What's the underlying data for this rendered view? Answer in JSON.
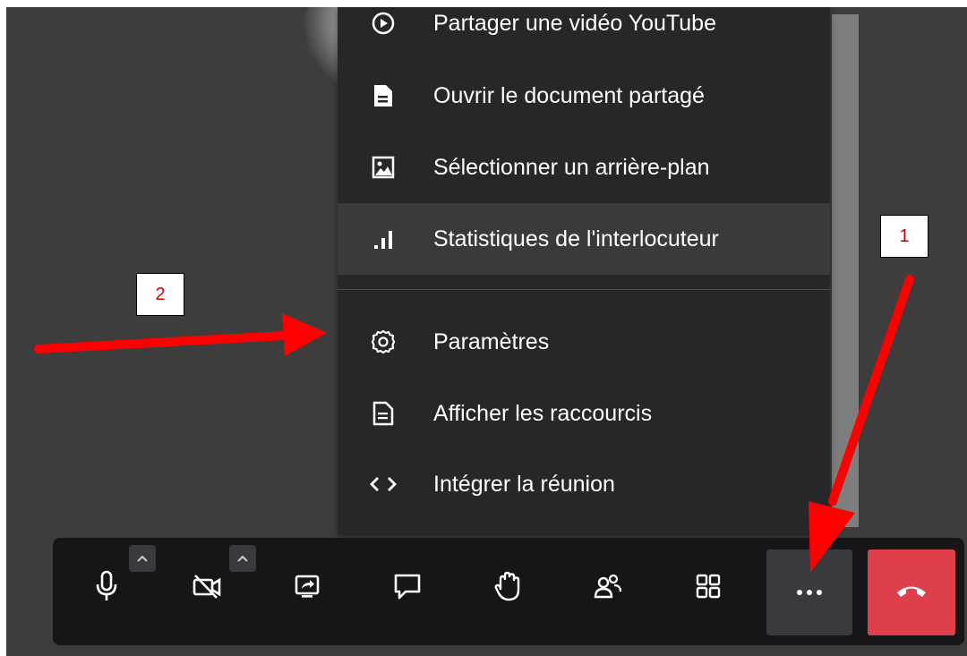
{
  "menu": {
    "items": [
      {
        "label": "Partager une vidéo YouTube",
        "icon": "play-circle-icon"
      },
      {
        "label": "Ouvrir le document partagé",
        "icon": "document-icon"
      },
      {
        "label": "Sélectionner un arrière-plan",
        "icon": "image-icon"
      },
      {
        "label": "Statistiques de l'interlocuteur",
        "icon": "signal-bars-icon"
      },
      {
        "label": "Paramètres",
        "icon": "gear-icon"
      },
      {
        "label": "Afficher les raccourcis",
        "icon": "shortcuts-document-icon"
      },
      {
        "label": "Intégrer la réunion",
        "icon": "code-embed-icon"
      }
    ]
  },
  "toolbar": {
    "buttons": [
      {
        "name": "microphone",
        "icon": "microphone-icon"
      },
      {
        "name": "camera",
        "icon": "camera-off-icon"
      },
      {
        "name": "share-screen",
        "icon": "screen-share-icon"
      },
      {
        "name": "chat",
        "icon": "chat-icon"
      },
      {
        "name": "raise-hand",
        "icon": "hand-icon"
      },
      {
        "name": "participants",
        "icon": "participants-icon"
      },
      {
        "name": "tile-view",
        "icon": "grid-icon"
      },
      {
        "name": "more-actions",
        "icon": "more-dots-icon"
      },
      {
        "name": "hangup",
        "icon": "hangup-icon"
      }
    ]
  },
  "annotations": {
    "callout_1": "1",
    "callout_2": "2"
  },
  "colors": {
    "hangup": "#dd3f4b",
    "arrow": "#ff0000",
    "callout_text": "#d00000"
  }
}
